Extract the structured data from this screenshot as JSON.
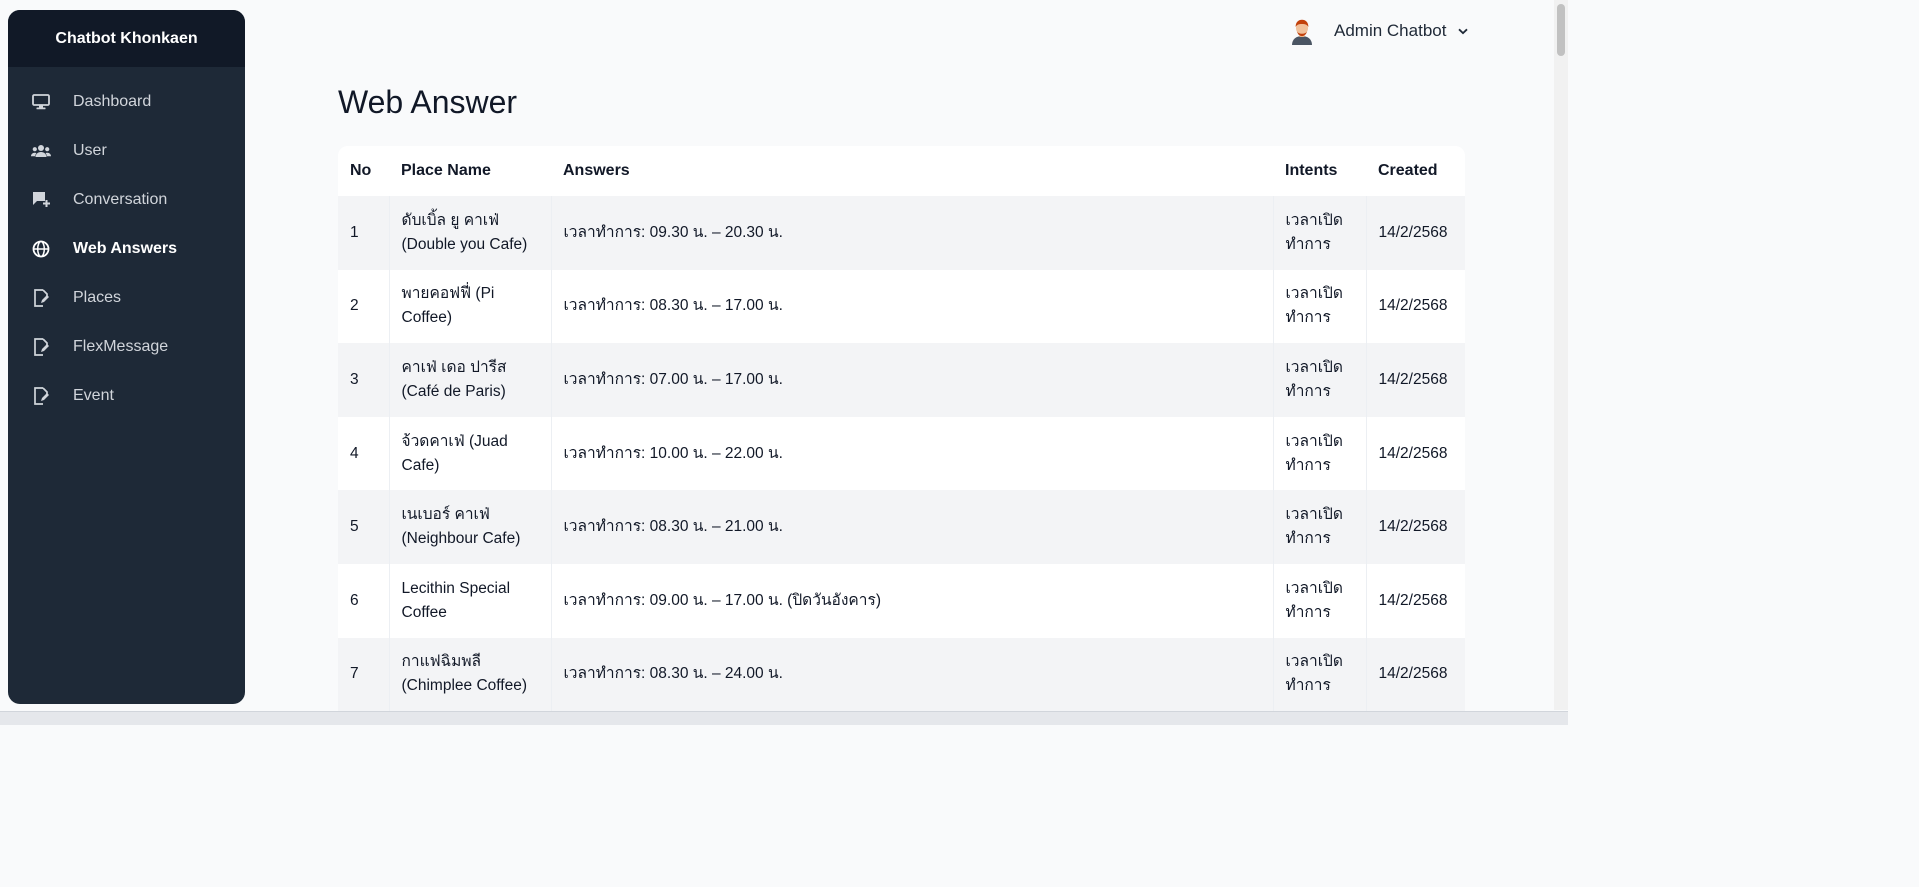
{
  "sidebar": {
    "brand": "Chatbot Khonkaen",
    "items": [
      {
        "label": "Dashboard",
        "icon": "monitor-icon"
      },
      {
        "label": "User",
        "icon": "users-icon"
      },
      {
        "label": "Conversation",
        "icon": "chat-add-icon"
      },
      {
        "label": "Web Answers",
        "icon": "globe-icon",
        "active": true
      },
      {
        "label": "Places",
        "icon": "file-edit-icon"
      },
      {
        "label": "FlexMessage",
        "icon": "file-edit-icon"
      },
      {
        "label": "Event",
        "icon": "file-edit-icon"
      }
    ]
  },
  "header": {
    "user_name": "Admin Chatbot",
    "dropdown_icon": "chevron-down-icon"
  },
  "page": {
    "title": "Web Answer"
  },
  "table": {
    "columns": [
      "No",
      "Place Name",
      "Answers",
      "Intents",
      "Created"
    ],
    "rows": [
      {
        "no": "1",
        "place": "ดับเบิ้ล ยู คาเฟ่ (Double you Cafe)",
        "answer": "เวลาทำการ: 09.30 น. – 20.30 น.",
        "intent": "เวลาเปิดทำการ",
        "created": "14/2/2568"
      },
      {
        "no": "2",
        "place": "พายคอฟฟี่ (Pi Coffee)",
        "answer": "เวลาทำการ: 08.30 น. – 17.00 น.",
        "intent": "เวลาเปิดทำการ",
        "created": "14/2/2568"
      },
      {
        "no": "3",
        "place": "คาเฟ่ เดอ ปารีส (Café de Paris)",
        "answer": "เวลาทำการ: 07.00 น. – 17.00 น.",
        "intent": "เวลาเปิดทำการ",
        "created": "14/2/2568"
      },
      {
        "no": "4",
        "place": "จ้วดคาเฟ่ (Juad Cafe)",
        "answer": "เวลาทำการ: 10.00 น. – 22.00 น.",
        "intent": "เวลาเปิดทำการ",
        "created": "14/2/2568"
      },
      {
        "no": "5",
        "place": "เนเบอร์ คาเฟ่ (Neighbour Cafe)",
        "answer": "เวลาทำการ: 08.30 น. – 21.00 น.",
        "intent": "เวลาเปิดทำการ",
        "created": "14/2/2568"
      },
      {
        "no": "6",
        "place": "Lecithin Special Coffee",
        "answer": "เวลาทำการ: 09.00 น. – 17.00 น. (ปิดวันอังคาร)",
        "intent": "เวลาเปิดทำการ",
        "created": "14/2/2568"
      },
      {
        "no": "7",
        "place": "กาแฟฉิมพลี (Chimplee Coffee)",
        "answer": "เวลาทำการ: 08.30 น. – 24.00 น.",
        "intent": "เวลาเปิดทำการ",
        "created": "14/2/2568"
      }
    ]
  },
  "colors": {
    "sidebar_bg": "#1e2937",
    "brand_bg": "#111927",
    "page_bg": "#f9fafb",
    "row_stripe": "#f3f4f6"
  }
}
